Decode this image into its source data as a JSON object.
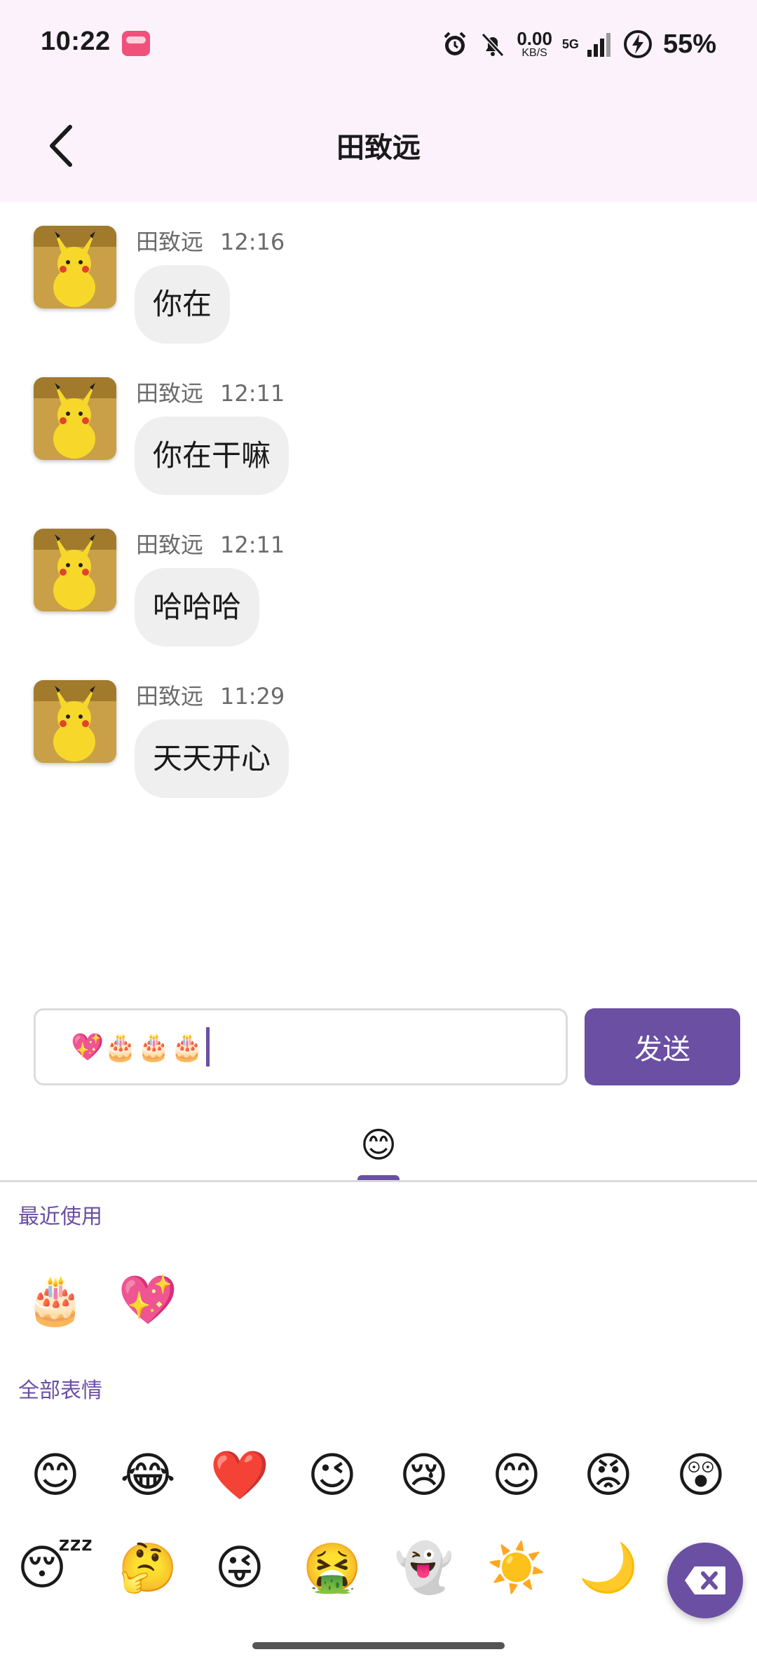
{
  "status_bar": {
    "time": "10:22",
    "net_speed_value": "0.00",
    "net_speed_unit": "KB/S",
    "network": "5G",
    "battery": "55%"
  },
  "header": {
    "title": "田致远"
  },
  "messages": [
    {
      "sender": "田致远",
      "time": "12:16",
      "text": "你在"
    },
    {
      "sender": "田致远",
      "time": "12:11",
      "text": "你在干嘛"
    },
    {
      "sender": "田致远",
      "time": "12:11",
      "text": "哈哈哈"
    },
    {
      "sender": "田致远",
      "time": "11:29",
      "text": "天天开心"
    }
  ],
  "composer": {
    "input_value": "💖🎂🎂🎂",
    "send_label": "发送"
  },
  "emoji_panel": {
    "tab_icon": "😊",
    "recent_label": "最近使用",
    "recent": [
      "🎂",
      "💖"
    ],
    "all_label": "全部表情",
    "all_row1": [
      "😊",
      "😂",
      "❤️",
      "😉",
      "😢",
      "😊",
      "😡",
      "😲"
    ],
    "all_row2": [
      "😴",
      "🤔",
      "😜",
      "🤮",
      "👻",
      "☀️",
      "🌙"
    ]
  },
  "colors": {
    "accent": "#6a4fa3",
    "header_bg": "#fbf2fc",
    "bubble_bg": "#efefef"
  }
}
